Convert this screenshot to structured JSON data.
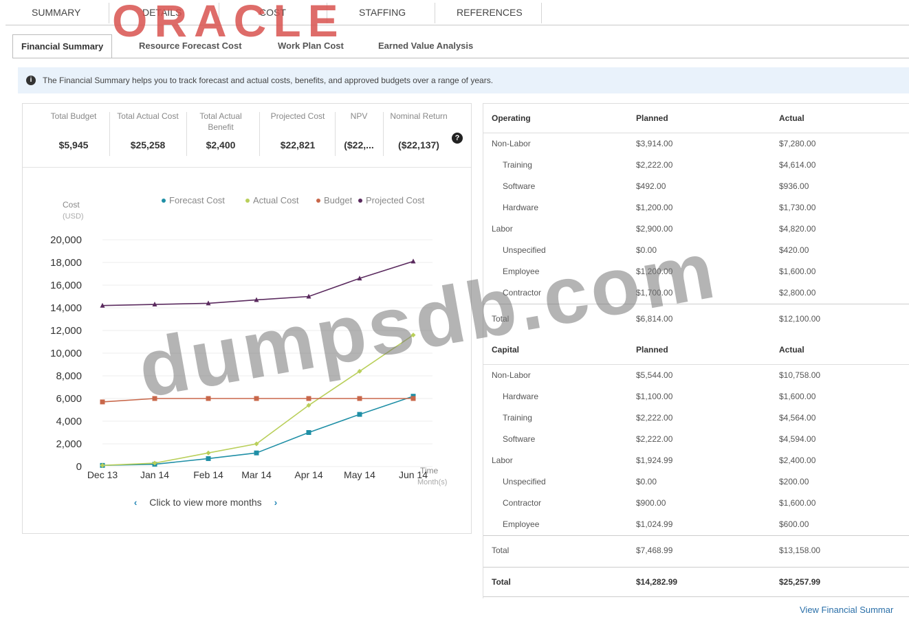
{
  "module_tabs": [
    "SUMMARY",
    "DETAILS",
    "COST",
    "STAFFING",
    "REFERENCES"
  ],
  "logo_text": "ORACLE",
  "sub_tabs": [
    "Financial Summary",
    "Resource Forecast Cost",
    "Work Plan Cost",
    "Earned Value Analysis"
  ],
  "info": {
    "icon": "info-circle-icon",
    "text": "The Financial Summary helps you to track forecast and actual costs, benefits, and approved budgets over a range of years."
  },
  "metrics": [
    {
      "label": "Total Budget",
      "value": "$5,945"
    },
    {
      "label": "Total Actual Cost",
      "value": "$25,258"
    },
    {
      "label": "Total Actual Benefit",
      "value": "$2,400"
    },
    {
      "label": "Projected Cost",
      "value": "$22,821"
    },
    {
      "label": "NPV",
      "value": "($22,..."
    },
    {
      "label": "Nominal Return",
      "value": "($22,137)"
    }
  ],
  "help_icon": "?",
  "chart_data": {
    "type": "line",
    "ylabel": "Cost",
    "ylabel_unit": "(USD)",
    "xlabel": "Time",
    "xlabel_unit": "Month(s)",
    "categories": [
      "Dec 13",
      "Jan 14",
      "Feb 14",
      "Mar 14",
      "Apr 14",
      "May 14",
      "Jun 14"
    ],
    "ylim": [
      0,
      20000
    ],
    "yticks": [
      "0",
      "2,000",
      "4,000",
      "6,000",
      "8,000",
      "10,000",
      "12,000",
      "14,000",
      "16,000",
      "18,000",
      "20,000"
    ],
    "legend_position": "top",
    "grid": true,
    "series": [
      {
        "name": "Forecast Cost",
        "color": "#1f8fa6",
        "marker": "square",
        "values": [
          100,
          200,
          700,
          1200,
          3000,
          4600,
          6200
        ]
      },
      {
        "name": "Actual Cost",
        "color": "#b9cf5a",
        "marker": "diamond",
        "values": [
          100,
          300,
          1200,
          2000,
          5400,
          8400,
          11600
        ]
      },
      {
        "name": "Budget",
        "color": "#c8674a",
        "marker": "square",
        "values": [
          5700,
          6000,
          6000,
          6000,
          6000,
          6000,
          6000
        ]
      },
      {
        "name": "Projected Cost",
        "color": "#5a2a5e",
        "marker": "triangle",
        "values": [
          14200,
          14300,
          14400,
          14700,
          15000,
          16600,
          18100
        ]
      }
    ]
  },
  "more_months": {
    "label": "Click to view more months",
    "prev_icon": "‹",
    "next_icon": "›"
  },
  "operating": {
    "headers": [
      "Operating",
      "Planned",
      "Actual"
    ],
    "rows": [
      {
        "label": "Non-Labor",
        "indent": false,
        "planned": "$3,914.00",
        "actual": "$7,280.00"
      },
      {
        "label": "Training",
        "indent": true,
        "planned": "$2,222.00",
        "actual": "$4,614.00"
      },
      {
        "label": "Software",
        "indent": true,
        "planned": "$492.00",
        "actual": "$936.00"
      },
      {
        "label": "Hardware",
        "indent": true,
        "planned": "$1,200.00",
        "actual": "$1,730.00"
      },
      {
        "label": "Labor",
        "indent": false,
        "planned": "$2,900.00",
        "actual": "$4,820.00"
      },
      {
        "label": "Unspecified",
        "indent": true,
        "planned": "$0.00",
        "actual": "$420.00"
      },
      {
        "label": "Employee",
        "indent": true,
        "planned": "$1,200.00",
        "actual": "$1,600.00"
      },
      {
        "label": "Contractor",
        "indent": true,
        "planned": "$1,700.00",
        "actual": "$2,800.00"
      }
    ],
    "total": {
      "label": "Total",
      "planned": "$6,814.00",
      "actual": "$12,100.00"
    }
  },
  "capital": {
    "headers": [
      "Capital",
      "Planned",
      "Actual"
    ],
    "rows": [
      {
        "label": "Non-Labor",
        "indent": false,
        "planned": "$5,544.00",
        "actual": "$10,758.00"
      },
      {
        "label": "Hardware",
        "indent": true,
        "planned": "$1,100.00",
        "actual": "$1,600.00"
      },
      {
        "label": "Training",
        "indent": true,
        "planned": "$2,222.00",
        "actual": "$4,564.00"
      },
      {
        "label": "Software",
        "indent": true,
        "planned": "$2,222.00",
        "actual": "$4,594.00"
      },
      {
        "label": "Labor",
        "indent": false,
        "planned": "$1,924.99",
        "actual": "$2,400.00"
      },
      {
        "label": "Unspecified",
        "indent": true,
        "planned": "$0.00",
        "actual": "$200.00"
      },
      {
        "label": "Contractor",
        "indent": true,
        "planned": "$900.00",
        "actual": "$1,600.00"
      },
      {
        "label": "Employee",
        "indent": true,
        "planned": "$1,024.99",
        "actual": "$600.00"
      }
    ],
    "total": {
      "label": "Total",
      "planned": "$7,468.99",
      "actual": "$13,158.00"
    }
  },
  "grand_total": {
    "label": "Total",
    "planned": "$14,282.99",
    "actual": "$25,257.99"
  },
  "view_link": "View Financial Summar",
  "watermark": "dumpsdb.com"
}
